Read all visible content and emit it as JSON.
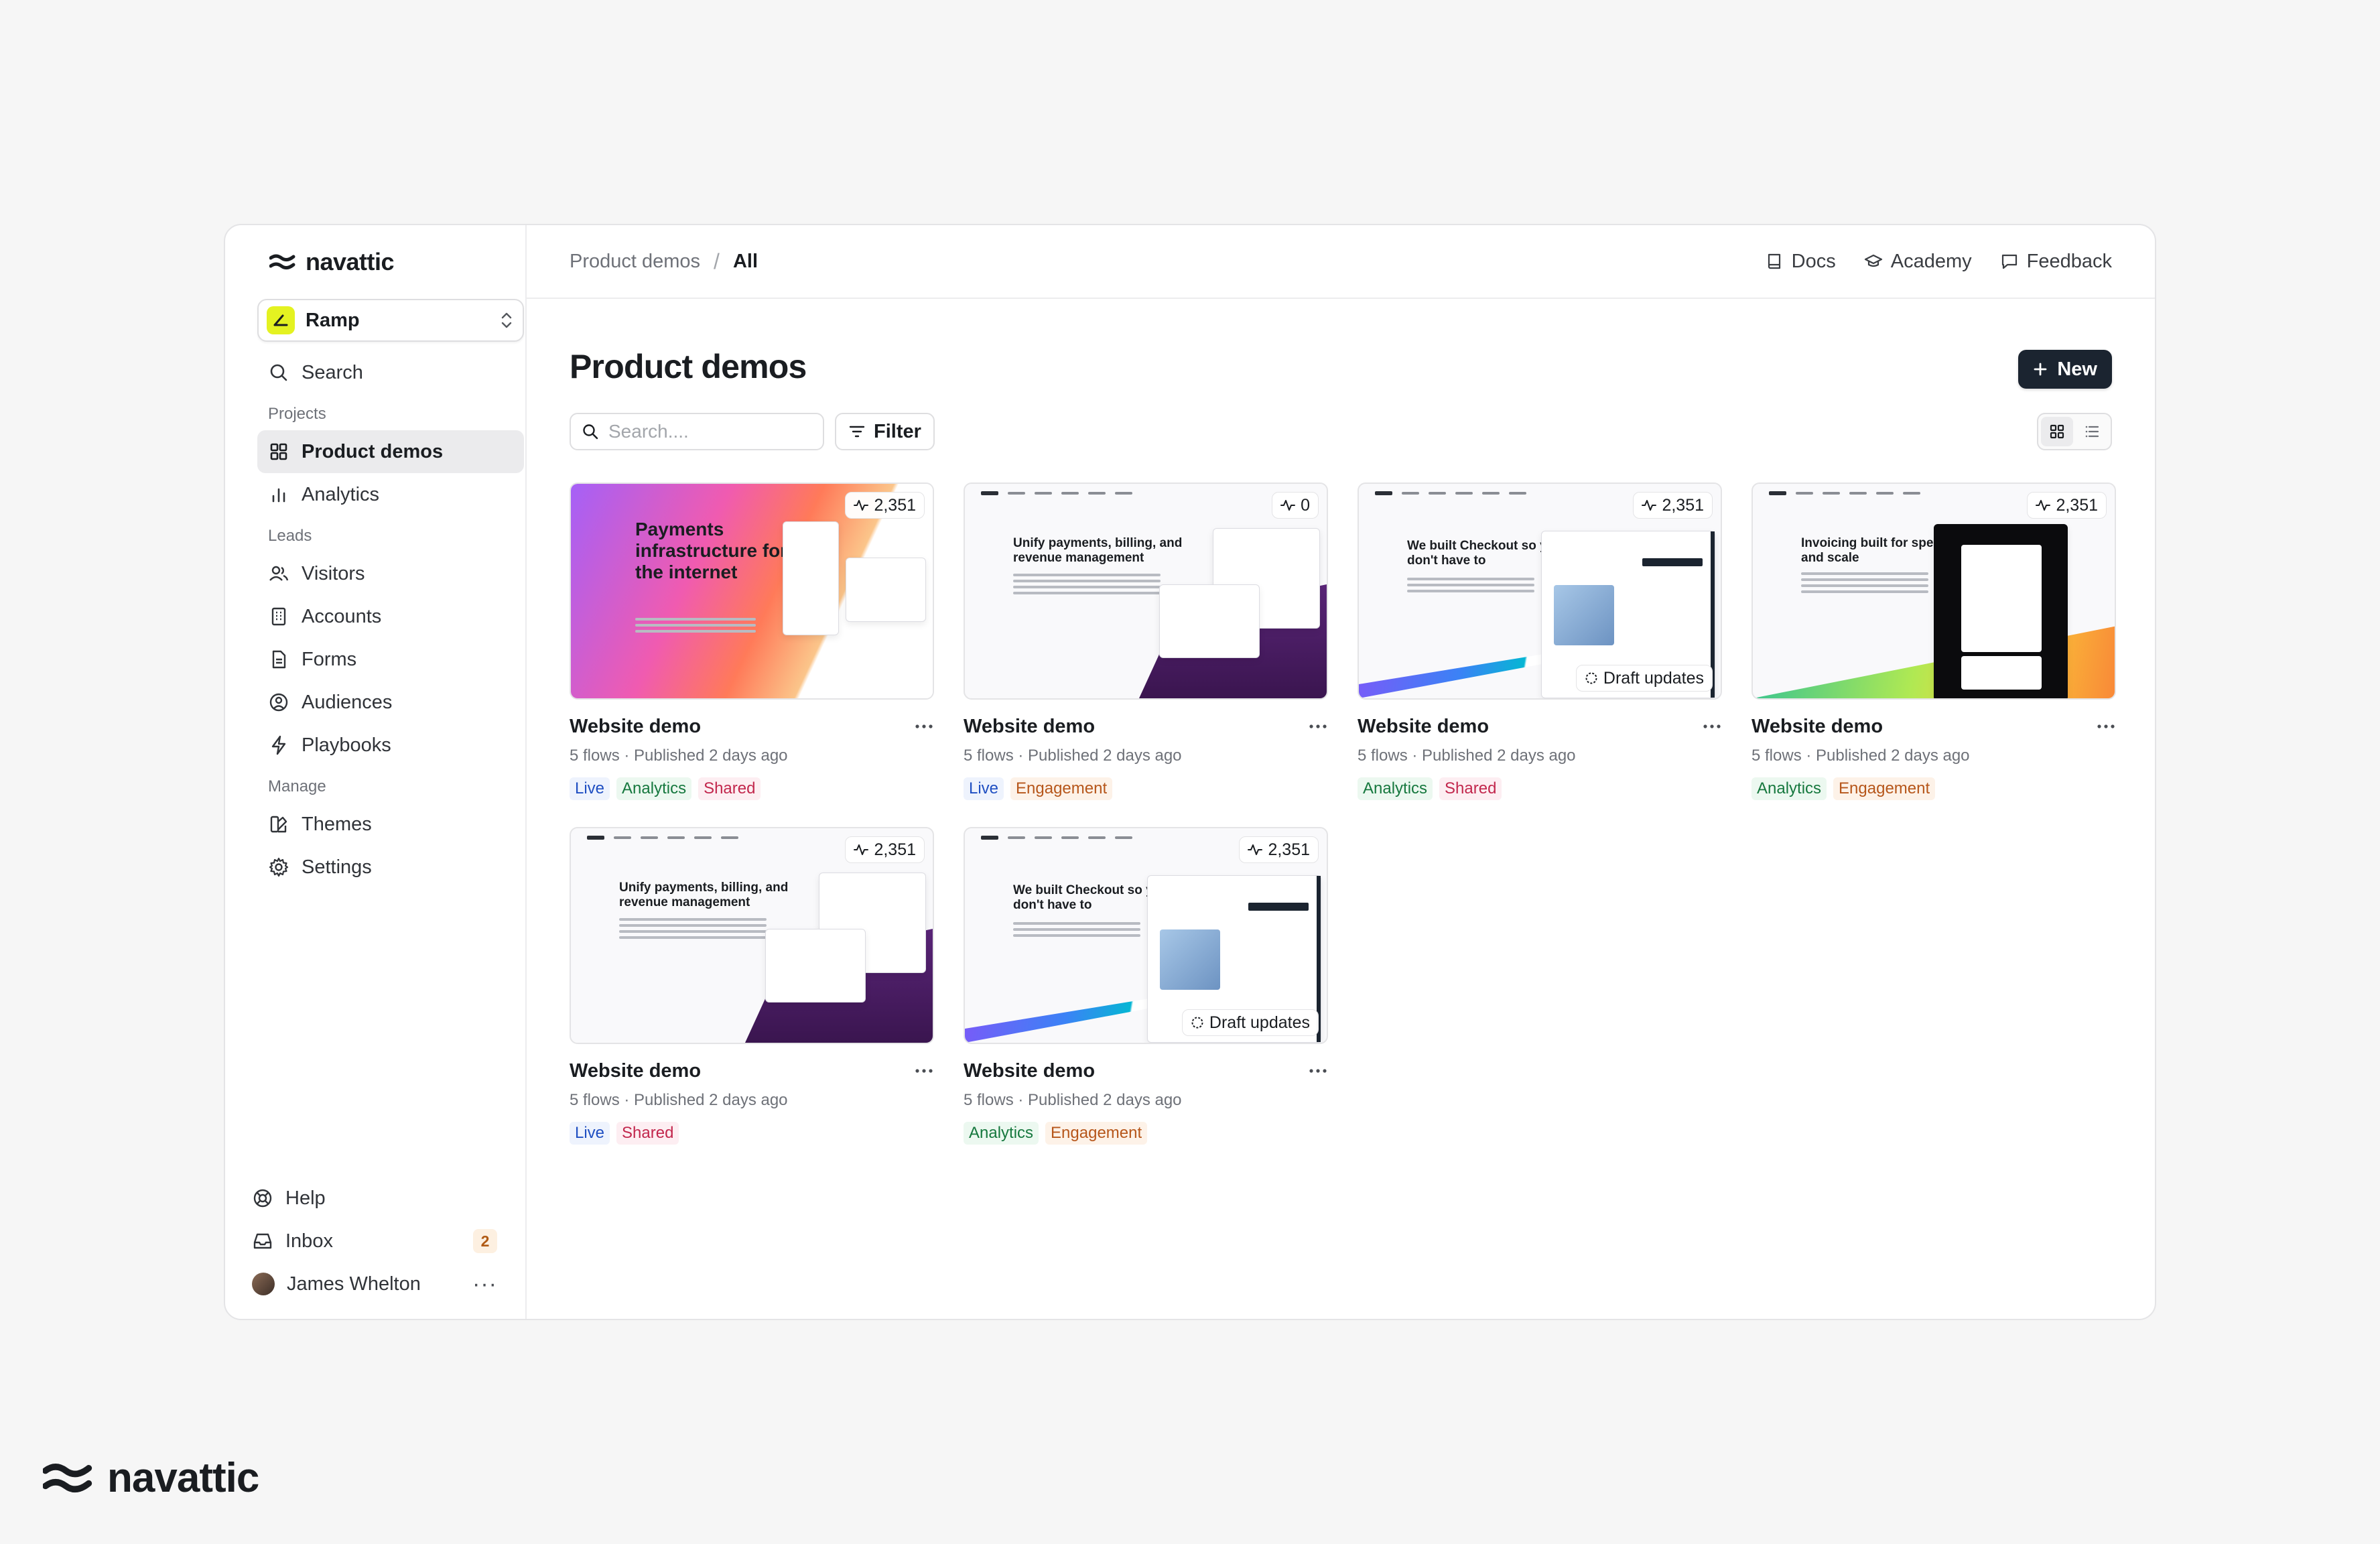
{
  "brand": {
    "name": "navattic"
  },
  "workspace": {
    "name": "Ramp"
  },
  "sidebar": {
    "search_label": "Search",
    "projects_label": "Projects",
    "projects": [
      {
        "label": "Product demos",
        "icon": "grid-icon",
        "active": true
      },
      {
        "label": "Analytics",
        "icon": "bar-chart-icon",
        "active": false
      }
    ],
    "leads_label": "Leads",
    "leads": [
      {
        "label": "Visitors",
        "icon": "users-icon"
      },
      {
        "label": "Accounts",
        "icon": "building-icon"
      },
      {
        "label": "Forms",
        "icon": "document-icon"
      },
      {
        "label": "Audiences",
        "icon": "user-circle-icon"
      },
      {
        "label": "Playbooks",
        "icon": "lightning-icon"
      }
    ],
    "manage_label": "Manage",
    "manage": [
      {
        "label": "Themes",
        "icon": "palette-icon"
      },
      {
        "label": "Settings",
        "icon": "gear-icon"
      }
    ],
    "help_label": "Help",
    "inbox_label": "Inbox",
    "inbox_count": "2",
    "user_name": "James Whelton",
    "user_menu": "···"
  },
  "topbar": {
    "breadcrumb": [
      "Product demos",
      "All"
    ],
    "separator": "/",
    "links": [
      {
        "label": "Docs",
        "icon": "book-icon"
      },
      {
        "label": "Academy",
        "icon": "graduation-cap-icon"
      },
      {
        "label": "Feedback",
        "icon": "message-icon"
      }
    ]
  },
  "main": {
    "title": "Product demos",
    "new_button": "New",
    "search_placeholder": "Search....",
    "filter_label": "Filter"
  },
  "cards": [
    {
      "title": "Website demo",
      "meta": "5 flows · Published 2 days ago",
      "views": "2,351",
      "draft": "",
      "variant": "payments",
      "tags": [
        "Live",
        "Analytics",
        "Shared"
      ]
    },
    {
      "title": "Website demo",
      "meta": "5 flows · Published 2 days ago",
      "views": "0",
      "draft": "",
      "variant": "billing",
      "tags": [
        "Live",
        "Engagement"
      ]
    },
    {
      "title": "Website demo",
      "meta": "5 flows · Published 2 days ago",
      "views": "2,351",
      "draft": "Draft updates",
      "variant": "checkout",
      "tags": [
        "Analytics",
        "Shared"
      ]
    },
    {
      "title": "Website demo",
      "meta": "5 flows · Published 2 days ago",
      "views": "2,351",
      "draft": "",
      "variant": "invoicing",
      "tags": [
        "Analytics",
        "Engagement"
      ]
    },
    {
      "title": "Website demo",
      "meta": "5 flows · Published 2 days ago",
      "views": "2,351",
      "draft": "",
      "variant": "billing",
      "tags": [
        "Live",
        "Shared"
      ]
    },
    {
      "title": "Website demo",
      "meta": "5 flows · Published 2 days ago",
      "views": "2,351",
      "draft": "Draft updates",
      "variant": "checkout",
      "tags": [
        "Analytics",
        "Engagement"
      ]
    }
  ],
  "thumb_text": {
    "payments": "Payments infrastructure for the internet",
    "billing": "Unify payments, billing, and revenue management",
    "checkout": "We built Checkout so you don't have to",
    "invoicing": "Invoicing built for speed and scale"
  },
  "footer_brand": "navattic",
  "colors": {
    "new_button": "#1b2430",
    "active_nav": "#ebebed",
    "workspace_logo": "#e4f221"
  }
}
